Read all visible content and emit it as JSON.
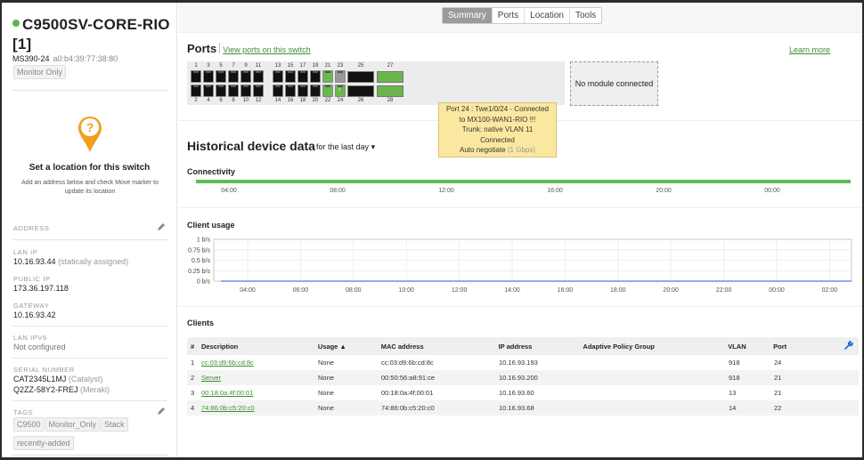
{
  "device": {
    "name": "C9500SV-CORE-RIO [1]",
    "status": "online",
    "status_color": "#5fb648",
    "model": "MS390-24",
    "mac": "a0:b4:39:77:38:80",
    "mode_badge": "Monitor Only"
  },
  "location": {
    "icon": "question-map-pin-icon",
    "title": "Set a location for this switch",
    "description": "Add an address below and check Move marker to update its location"
  },
  "details": {
    "address_label": "ADDRESS",
    "lan_ip_label": "LAN IP",
    "lan_ip": "10.16.93.44",
    "lan_ip_note": "(statically assigned)",
    "public_ip_label": "PUBLIC IP",
    "public_ip": "173.36.197.118",
    "gateway_label": "GATEWAY",
    "gateway": "10.16.93.42",
    "lan_ipv6_label": "LAN IPV6",
    "lan_ipv6": "Not configured",
    "serial_label": "SERIAL NUMBER",
    "serial_catalyst": "CAT2345L1MJ",
    "serial_catalyst_note": "(Catalyst)",
    "serial_meraki": "Q2ZZ-58Y2-FREJ",
    "serial_meraki_note": "(Meraki)",
    "tags_label": "TAGS",
    "tags": [
      "C9500",
      "Monitor_Only",
      "Stack",
      "recently-added"
    ]
  },
  "tabs": [
    {
      "label": "Summary",
      "active": true
    },
    {
      "label": "Ports",
      "active": false
    },
    {
      "label": "Location",
      "active": false
    },
    {
      "label": "Tools",
      "active": false
    }
  ],
  "ports": {
    "title": "Ports",
    "view_link": "View ports on this switch",
    "learn_more": "Learn more",
    "module_text": "No module connected",
    "top_numbers": [
      "1",
      "3",
      "5",
      "7",
      "9",
      "11",
      "13",
      "15",
      "17",
      "19",
      "21",
      "23"
    ],
    "bottom_numbers": [
      "2",
      "4",
      "6",
      "8",
      "10",
      "12",
      "14",
      "16",
      "18",
      "20",
      "22",
      "24"
    ],
    "top_states": [
      "off",
      "off",
      "off",
      "off",
      "off",
      "off",
      "off",
      "off",
      "off",
      "off",
      "connected",
      "disabled"
    ],
    "bottom_states": [
      "off",
      "off",
      "off",
      "off",
      "off",
      "off",
      "off",
      "off",
      "off",
      "off",
      "connected",
      "uplink"
    ],
    "uplink_numbers": {
      "top": [
        "25",
        "27"
      ],
      "bottom": [
        "26",
        "28"
      ]
    },
    "uplink_states": {
      "top": [
        "off",
        "connected"
      ],
      "bottom": [
        "off",
        "connected"
      ]
    },
    "tooltip": {
      "line1": "Port 24 : Twe1/0/24 - Connected",
      "line2": "to MX100-WAN1-RIO !!!",
      "line3": "Trunk: native VLAN 11",
      "line4": "Connected",
      "line5": "Auto negotiate",
      "speed": "(1 Gbps)"
    }
  },
  "historical": {
    "title": "Historical device data",
    "range": "for the last day",
    "connectivity_title": "Connectivity",
    "connectivity_status": "connected for full period",
    "connectivity_color": "#5bbf56",
    "connectivity_ticks": [
      "04:00",
      "08:00",
      "12:00",
      "16:00",
      "20:00",
      "00:00"
    ],
    "client_usage_title": "Client usage"
  },
  "chart_data": {
    "type": "line",
    "title": "Client usage",
    "xlabel": "",
    "ylabel": "",
    "x": [
      "04:00",
      "06:00",
      "08:00",
      "10:00",
      "12:00",
      "14:00",
      "16:00",
      "18:00",
      "20:00",
      "22:00",
      "00:00",
      "02:00"
    ],
    "y_ticks": [
      "1 b/s",
      "0.75 b/s",
      "0.5 b/s",
      "0.25 b/s",
      "0 b/s"
    ],
    "ylim": [
      0,
      1
    ],
    "grid": true,
    "series": [
      {
        "name": "usage",
        "color": "#6b8ff0",
        "values": [
          0,
          0,
          0,
          0,
          0,
          0,
          0,
          0,
          0,
          0,
          0,
          0
        ]
      }
    ]
  },
  "clients": {
    "title": "Clients",
    "columns": [
      "#",
      "Description",
      "Usage ▲",
      "MAC address",
      "IP address",
      "Adaptive Policy Group",
      "VLAN",
      "Port"
    ],
    "rows": [
      {
        "num": "1",
        "description": "cc:03:d9:6b:cd:8c",
        "usage": "None",
        "mac": "cc:03:d9:6b:cd:8c",
        "ip": "10.16.93.193",
        "apg": "",
        "vlan": "918",
        "port": "24"
      },
      {
        "num": "2",
        "description": "Server",
        "usage": "None",
        "mac": "00:50:56:a8:91:ce",
        "ip": "10.16.93.200",
        "apg": "",
        "vlan": "918",
        "port": "21"
      },
      {
        "num": "3",
        "description": "00:18:0a:4f:00:01",
        "usage": "None",
        "mac": "00:18:0a:4f:00:01",
        "ip": "10.16.93.60",
        "apg": "",
        "vlan": "13",
        "port": "21"
      },
      {
        "num": "4",
        "description": "74:86:0b:c5:20:c0",
        "usage": "None",
        "mac": "74:86:0b:c5:20:c0",
        "ip": "10.16.93.68",
        "apg": "",
        "vlan": "14",
        "port": "22"
      }
    ],
    "settings_icon": "wrench-icon"
  }
}
